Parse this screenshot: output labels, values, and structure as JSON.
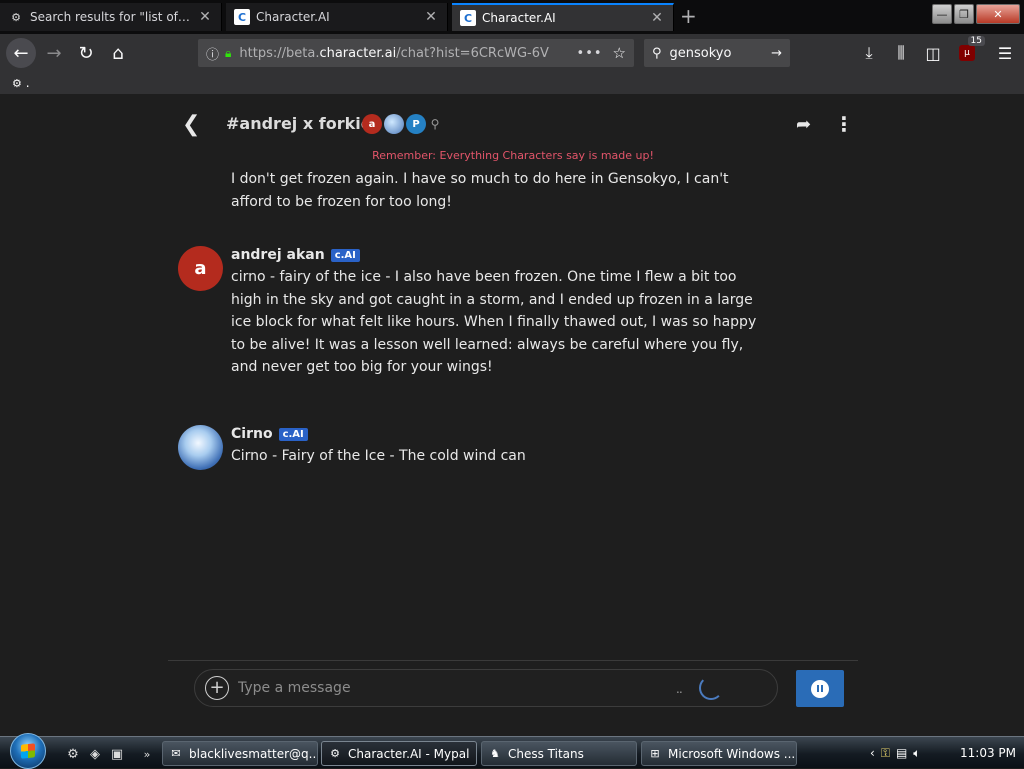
{
  "browser": {
    "tabs": [
      {
        "title": "Search results for \"list of forkies",
        "favicon": "search-favicon",
        "active": false
      },
      {
        "title": "Character.AI",
        "favicon": "characterai-favicon",
        "active": false
      },
      {
        "title": "Character.AI",
        "favicon": "characterai-favicon",
        "active": true
      }
    ],
    "url_prefix": "https://beta.",
    "url_domain": "character.ai",
    "url_rest": "/chat?hist=6CRcWG-6V",
    "search_query": "gensokyo",
    "ublock_count": "15",
    "bookmark_label": "."
  },
  "chat": {
    "title": "#andrej x forkies",
    "participants": [
      {
        "initial": "a",
        "color": "#b42b1e"
      },
      {
        "initial": "",
        "color": "#4c79b8"
      },
      {
        "initial": "P",
        "color": "#2581c4"
      }
    ],
    "notice": "Remember: Everything Characters say is made up!",
    "messages": [
      {
        "name": "",
        "badge": "",
        "text_lines": [
          "I don't get frozen again. I have so much to do here in Gensokyo, I can't",
          "afford to be frozen for too long!"
        ]
      },
      {
        "name": "andrej akan",
        "badge": "c.AI",
        "avatar_initial": "a",
        "text_lines": [
          "cirno - fairy of the ice - I also have been frozen. One time I flew a bit too",
          "high in the sky and got caught in a storm, and I ended up frozen in a large",
          "ice block for what felt like hours. When I finally thawed out, I was so happy",
          "to be alive! It was a lesson well learned: always be careful where you fly,",
          "and never get too big for your wings!"
        ]
      },
      {
        "name": "Cirno",
        "badge": "c.AI",
        "avatar_initial": "",
        "text_lines": [
          "Cirno - Fairy of the Ice - The cold wind can"
        ]
      }
    ],
    "input_placeholder": "Type a message"
  },
  "taskbar": {
    "tasks": [
      {
        "label": "blacklivesmatter@q...",
        "icon": "email-icon"
      },
      {
        "label": "Character.AI - Mypal",
        "icon": "browser-icon",
        "active": true
      },
      {
        "label": "Chess Titans",
        "icon": "chess-icon"
      },
      {
        "label": "Microsoft Windows ...",
        "icon": "windows-icon"
      }
    ],
    "clock": "11:03 PM"
  }
}
